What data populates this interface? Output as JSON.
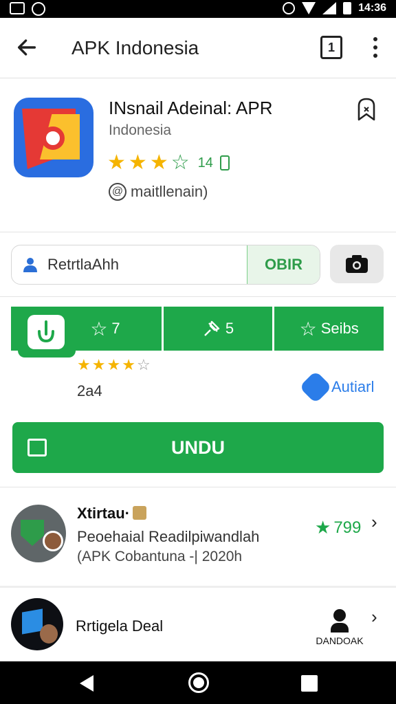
{
  "status_bar": {
    "time": "14:36"
  },
  "app_bar": {
    "title": "APK Indonesia",
    "tabs_count": "1"
  },
  "app": {
    "name": "INsnail Adeinal: APR",
    "subtitle": "Indonesia",
    "stars": 3.5,
    "rating_text": "14",
    "developer": "maitllenain)"
  },
  "search": {
    "value": "RetrtlaAhh",
    "button_label": "OBIR"
  },
  "stats": {
    "items": [
      {
        "icon": "star-outline-icon",
        "value": "7"
      },
      {
        "icon": "pin-icon",
        "value": "5"
      },
      {
        "icon": "star-outline-icon",
        "value": "Seibs"
      }
    ],
    "mini_stars": 4,
    "count": "2a4",
    "autian_label": "Autiarl"
  },
  "download_button": {
    "label": "UNDU"
  },
  "list": [
    {
      "title": "Xtirtau·",
      "line1": "Peoehaial Readilpiwandlah",
      "line2": "(APK Cobantuna -| 2020h",
      "rating": "799"
    },
    {
      "title": "Rrtigela Deal",
      "action_label": "DANDOAK"
    }
  ]
}
